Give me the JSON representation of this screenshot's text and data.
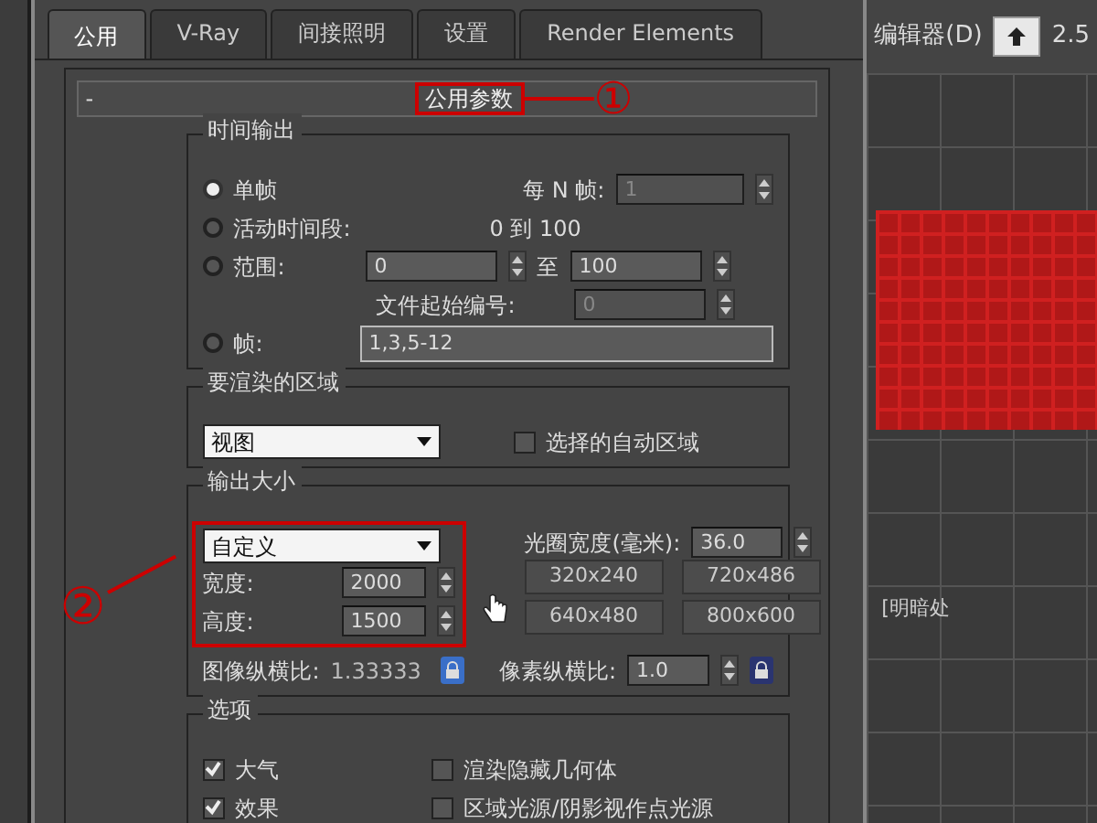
{
  "app_toolbar": {
    "menu_text": "编辑器(D)",
    "value_text": "2.5"
  },
  "tabs": [
    {
      "label": "公用",
      "selected": true
    },
    {
      "label": "V-Ray",
      "selected": false
    },
    {
      "label": "间接照明",
      "selected": false
    },
    {
      "label": "设置",
      "selected": false
    },
    {
      "label": "Render Elements",
      "selected": false
    }
  ],
  "rollout": {
    "collapse_sign": "-",
    "title": "公用参数"
  },
  "time_output": {
    "title": "时间输出",
    "every_n_label": "每 N 帧:",
    "every_n_value": "1",
    "every_n_disabled": true,
    "options": [
      {
        "label": "单帧",
        "selected": true
      },
      {
        "label": "活动时间段:",
        "selected": false
      },
      {
        "label": "范围:",
        "selected": false
      },
      {
        "label": "帧:",
        "selected": false
      }
    ],
    "active_range": "0 到 100",
    "range_from": "0",
    "range_to_label": "至",
    "range_to": "100",
    "file_start_label": "文件起始编号:",
    "file_start_value": "0",
    "file_start_disabled": true,
    "frames_value": "1,3,5-12"
  },
  "area": {
    "title": "要渲染的区域",
    "dropdown": "视图",
    "auto_region": {
      "label": "选择的自动区域",
      "checked": false
    }
  },
  "output_size": {
    "title": "输出大小",
    "dropdown": "自定义",
    "aperture_label": "光圈宽度(毫米):",
    "aperture_value": "36.0",
    "width_label": "宽度:",
    "width_value": "2000",
    "height_label": "高度:",
    "height_value": "1500",
    "presets": [
      "320x240",
      "720x486",
      "640x480",
      "800x600"
    ],
    "image_aspect_label": "图像纵横比:",
    "image_aspect_value": "1.33333",
    "image_aspect_locked": true,
    "pixel_aspect_label": "像素纵横比:",
    "pixel_aspect_value": "1.0",
    "pixel_aspect_locked": false
  },
  "options": {
    "title": "选项",
    "items": [
      {
        "label": "大气",
        "checked": true
      },
      {
        "label": "渲染隐藏几何体",
        "checked": false
      },
      {
        "label": "效果",
        "checked": true
      },
      {
        "label": "区域光源/阴影视作点光源",
        "checked": false
      }
    ]
  },
  "annotations": [
    {
      "label": "①"
    },
    {
      "label": "②"
    }
  ],
  "viewport": {
    "label": "[明暗处"
  }
}
